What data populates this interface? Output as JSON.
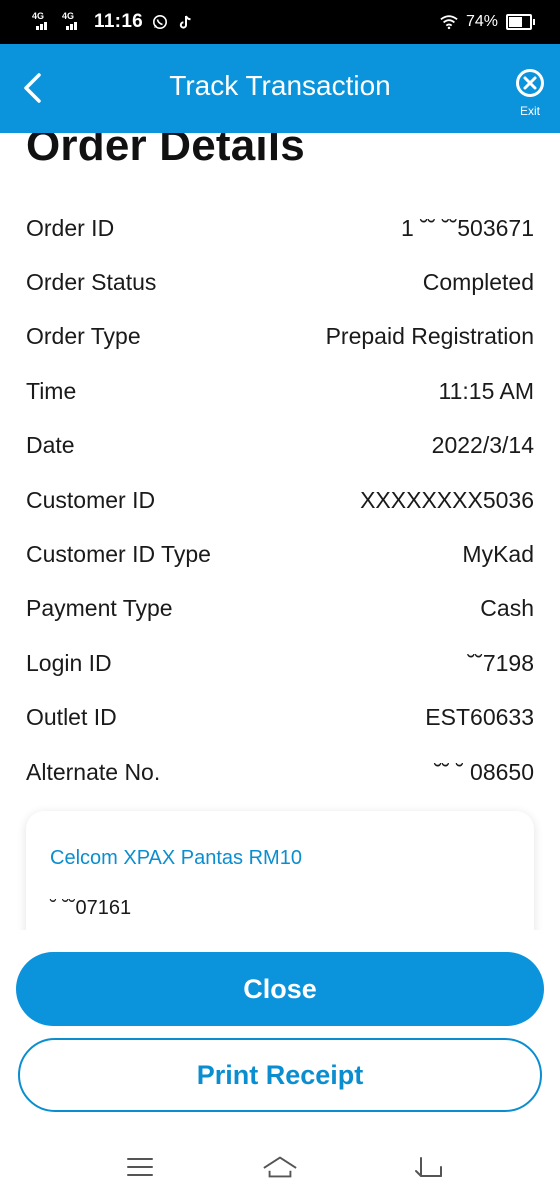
{
  "status_bar": {
    "network1": "4G",
    "network2": "4G",
    "time": "11:16",
    "battery_percent": "74%",
    "battery_level": 0.74,
    "icons": [
      "whatsapp-icon",
      "tiktok-icon",
      "wifi-icon",
      "battery-icon"
    ]
  },
  "header": {
    "title": "Track Transaction",
    "exit_label": "Exit",
    "background": "#0b93dc"
  },
  "page": {
    "title": "Order Details"
  },
  "details": [
    {
      "label": "Order ID",
      "value": "1 ˘˘ ˘˘503671"
    },
    {
      "label": "Order Status",
      "value": "Completed"
    },
    {
      "label": "Order Type",
      "value": "Prepaid Registration"
    },
    {
      "label": "Time",
      "value": "11:15 AM"
    },
    {
      "label": "Date",
      "value": "2022/3/14"
    },
    {
      "label": "Customer ID",
      "value": "XXXXXXXX5036"
    },
    {
      "label": "Customer ID Type",
      "value": "MyKad"
    },
    {
      "label": "Payment Type",
      "value": "Cash"
    },
    {
      "label": "Login ID",
      "value": "˘˘7198"
    },
    {
      "label": "Outlet ID",
      "value": "EST60633"
    },
    {
      "label": "Alternate No.",
      "value": "˘˘ ˘ 08650"
    }
  ],
  "card": {
    "title": "Celcom XPAX Pantas RM10",
    "number": "˘  ˘˘07161"
  },
  "buttons": {
    "close": "Close",
    "print": "Print Receipt"
  },
  "colors": {
    "accent": "#0b93dc",
    "link": "#0b8ecf"
  }
}
